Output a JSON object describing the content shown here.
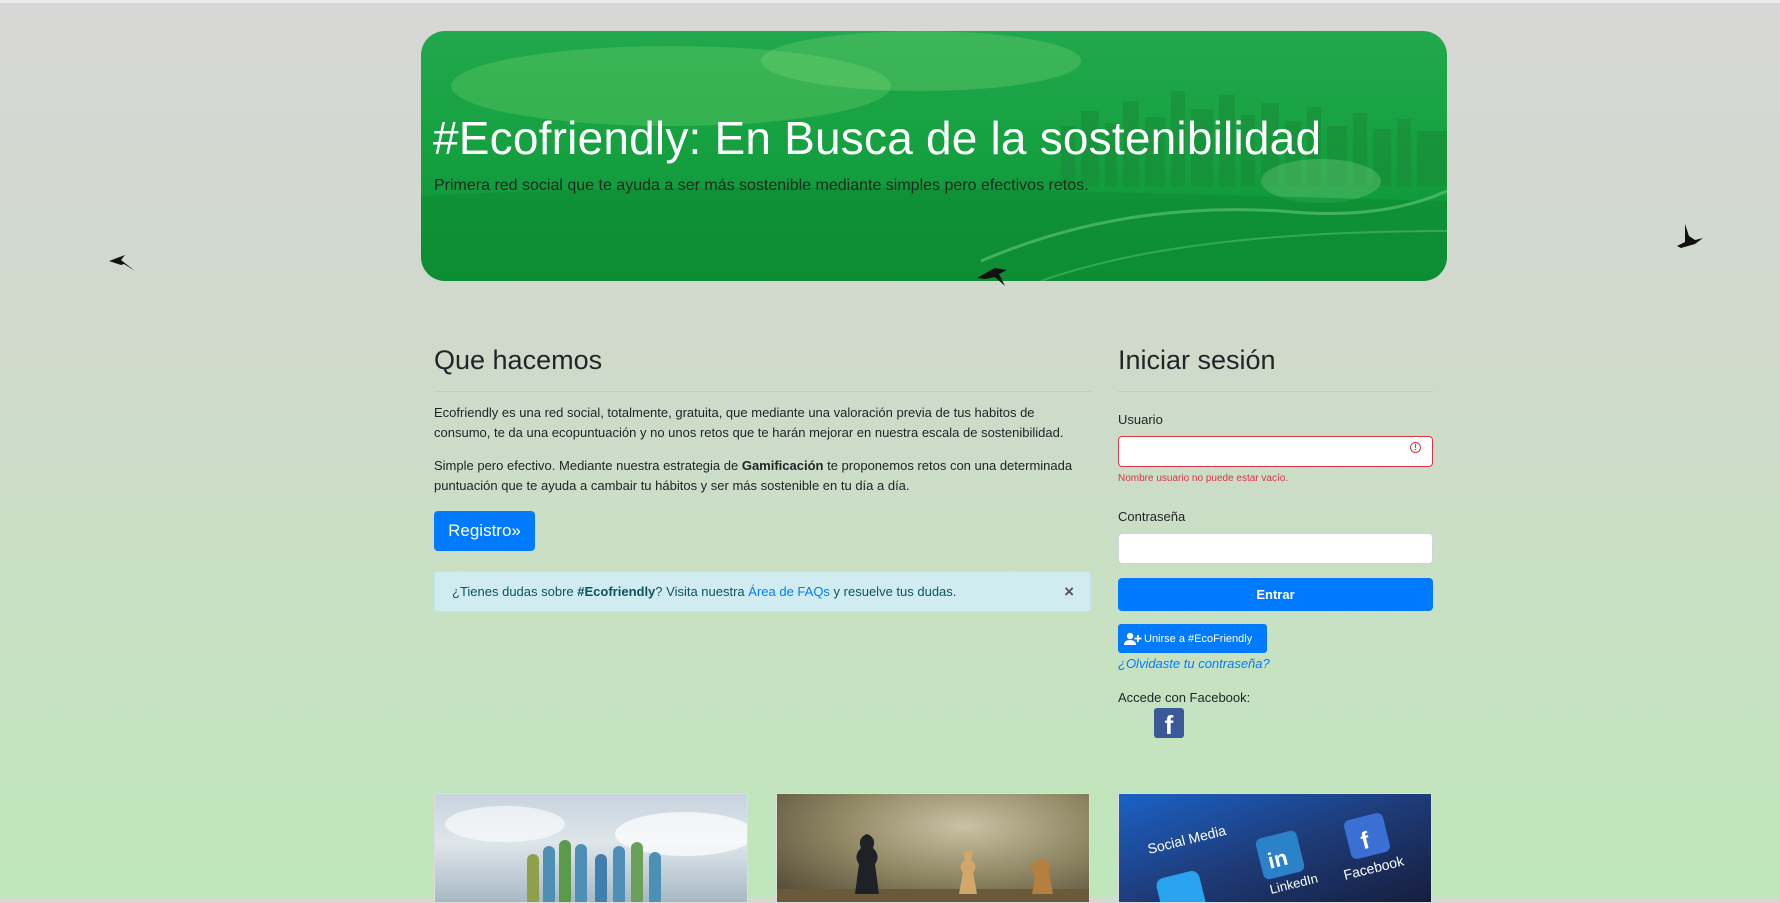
{
  "hero": {
    "title": "#Ecofriendly: En Busca de la sostenibilidad",
    "subtitle": "Primera red social que te ayuda a ser más sostenible mediante simples pero efectivos retos."
  },
  "about": {
    "heading": "Que hacemos",
    "p1": "Ecofriendly es una red social, totalmente, gratuita, que mediante una valoración previa de tus habitos de consumo, te da una ecopuntuación y no unos retos que te harán mejorar en nuestra escala de sostenibilidad.",
    "p2_before": "Simple pero efectivo. Mediante nuestra estrategia de ",
    "p2_bold": "Gamificación",
    "p2_after": " te proponemos retos con una determinada puntuación que te ayuda a cambair tu hábitos y ser más sostenible en tu día a día.",
    "register_button": "Registro»"
  },
  "faq_alert": {
    "before": "¿Tienes dudas sobre ",
    "bold": "#Ecofriendly",
    "middle": "? Visita nuestra ",
    "link": "Área de FAQs",
    "after": " y resuelve tus dudas.",
    "close": "×"
  },
  "login": {
    "heading": "Iniciar sesión",
    "user_label": "Usuario",
    "user_value": "",
    "user_error_icon": "!",
    "user_error": "Nombre usuario no puede estar vacío.",
    "password_label": "Contraseña",
    "password_value": "",
    "submit": "Entrar",
    "join_button": "Unirse a #EcoFriendly",
    "forgot": "¿Olvidaste tu contraseña?",
    "facebook_label": "Accede con Facebook:",
    "facebook_icon": "f"
  },
  "cards": [
    {
      "image": "painted-hands-photo"
    },
    {
      "image": "chess-pieces-photo"
    },
    {
      "image": "social-media-apps-photo",
      "labels": [
        "Social Media",
        "LinkedIn",
        "Facebook"
      ]
    }
  ],
  "colors": {
    "primary": "#007bff",
    "hero_green": "#17a242",
    "error": "#dc3545",
    "alert_bg": "#d1ecf1",
    "facebook": "#3b5998"
  }
}
